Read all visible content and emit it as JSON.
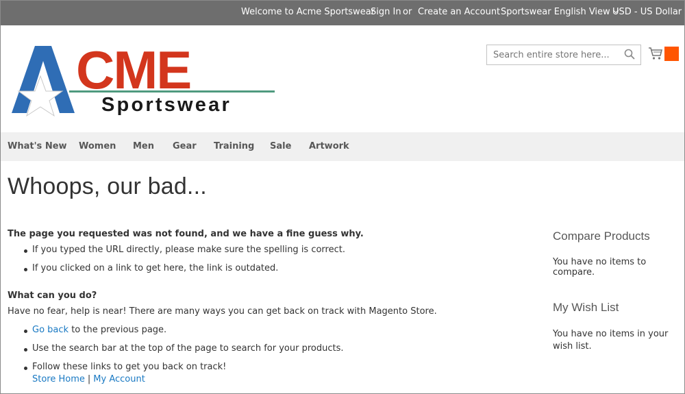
{
  "topbar": {
    "welcome": "Welcome to Acme Sportswear",
    "sign_in": "Sign In",
    "or": "or",
    "create_account": "Create an Account",
    "store_view": "Sportswear English View",
    "currency": "USD - US Dollar"
  },
  "header": {
    "logo_text_main": "ACME",
    "logo_text_sub": "Sportswear",
    "search_placeholder": "Search entire store here..."
  },
  "nav": {
    "items": [
      "What's New",
      "Women",
      "Men",
      "Gear",
      "Training",
      "Sale",
      "Artwork"
    ]
  },
  "main": {
    "title": "Whoops, our bad...",
    "not_found_heading": "The page you requested was not found, and we have a fine guess why.",
    "reasons": [
      "If you typed the URL directly, please make sure the spelling is correct.",
      "If you clicked on a link to get here, the link is outdated."
    ],
    "what_heading": "What can you do?",
    "help_text": "Have no fear, help is near! There are many ways you can get back on track with Magento Store.",
    "go_back_link": "Go back",
    "go_back_rest": "to the previous page.",
    "search_tip": "Use the search bar at the top of the page to search for your products.",
    "follow_tip": "Follow these links to get you back on track!",
    "store_home_link": "Store Home",
    "link_separator": "|",
    "my_account_link": "My Account"
  },
  "sidebar": {
    "compare_title": "Compare Products",
    "compare_text": "You have no items to compare.",
    "wishlist_title": "My Wish List",
    "wishlist_text": "You have no items in your wish list."
  },
  "colors": {
    "topbar_bg": "#6e6e6e",
    "nav_bg": "#f0f0f0",
    "link": "#1979c3",
    "cart_badge": "#ff5501",
    "logo_red": "#d3361d",
    "logo_blue": "#2f6db5"
  }
}
